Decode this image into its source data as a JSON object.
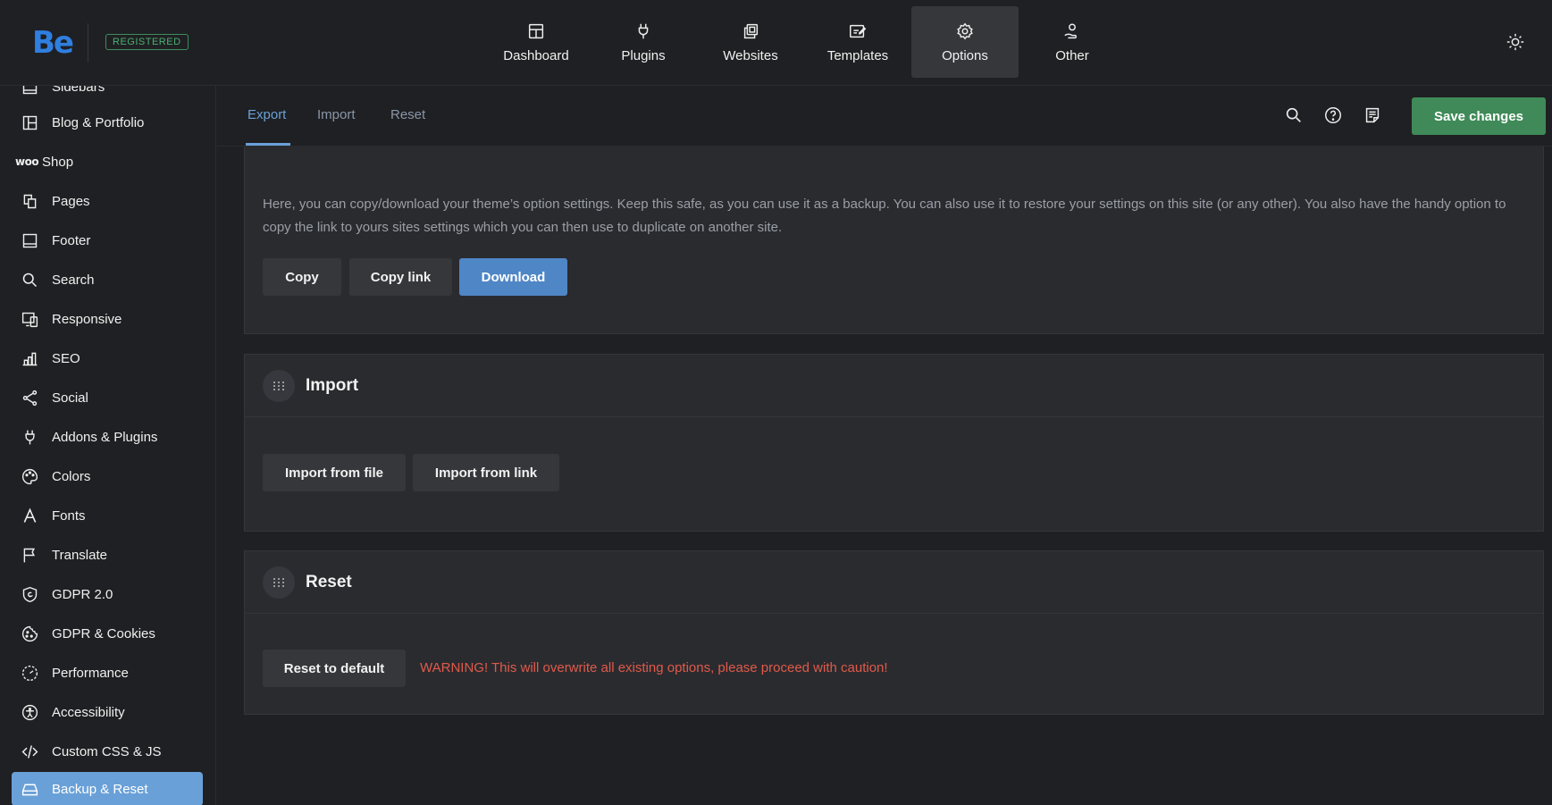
{
  "header": {
    "logo": "Be",
    "badge": "REGISTERED",
    "nav": [
      {
        "label": "Dashboard",
        "icon": "dashboard-icon"
      },
      {
        "label": "Plugins",
        "icon": "plug-icon"
      },
      {
        "label": "Websites",
        "icon": "websites-icon"
      },
      {
        "label": "Templates",
        "icon": "templates-icon"
      },
      {
        "label": "Options",
        "icon": "gear-icon",
        "active": true
      },
      {
        "label": "Other",
        "icon": "user-hand-icon"
      }
    ]
  },
  "sidebar": {
    "partial_top_label": "Sidebars",
    "items": [
      {
        "label": "Blog & Portfolio",
        "icon": "layout-icon"
      },
      {
        "label": "Shop",
        "icon": "woo-icon",
        "prefix": "woo"
      },
      {
        "label": "Pages",
        "icon": "pages-icon"
      },
      {
        "label": "Footer",
        "icon": "footer-icon"
      },
      {
        "label": "Search",
        "icon": "search-icon"
      },
      {
        "label": "Responsive",
        "icon": "responsive-icon"
      },
      {
        "label": "SEO",
        "icon": "chart-icon"
      },
      {
        "label": "Social",
        "icon": "share-icon"
      },
      {
        "label": "Addons & Plugins",
        "icon": "plug-icon"
      },
      {
        "label": "Colors",
        "icon": "palette-icon"
      },
      {
        "label": "Fonts",
        "icon": "font-icon"
      },
      {
        "label": "Translate",
        "icon": "flag-icon"
      },
      {
        "label": "GDPR 2.0",
        "icon": "shield-icon"
      },
      {
        "label": "GDPR & Cookies",
        "icon": "cookie-icon"
      },
      {
        "label": "Performance",
        "icon": "performance-icon"
      },
      {
        "label": "Accessibility",
        "icon": "accessibility-icon"
      },
      {
        "label": "Custom CSS & JS",
        "icon": "code-icon"
      },
      {
        "label": "Backup & Reset",
        "icon": "backup-icon",
        "active": true
      }
    ]
  },
  "subbar": {
    "tabs": [
      "Export",
      "Import",
      "Reset"
    ],
    "active_tab": "Export",
    "save_label": "Save changes"
  },
  "export": {
    "description": "Here, you can copy/download your theme’s option settings. Keep this safe, as you can use it as a backup. You can also use it to restore your settings on this site (or any other). You also have the handy option to copy the link to yours sites settings which you can then use to duplicate on another site.",
    "copy_label": "Copy",
    "copy_link_label": "Copy link",
    "download_label": "Download"
  },
  "import": {
    "title": "Import",
    "from_file_label": "Import from file",
    "from_link_label": "Import from link"
  },
  "reset": {
    "title": "Reset",
    "button_label": "Reset to default",
    "warning": "WARNING! This will overwrite all existing options, please proceed with caution!"
  },
  "colors": {
    "accent": "#6aa0d8",
    "save": "#3f8a58",
    "warning": "#e05a4a",
    "brand": "#2f7fe0"
  }
}
